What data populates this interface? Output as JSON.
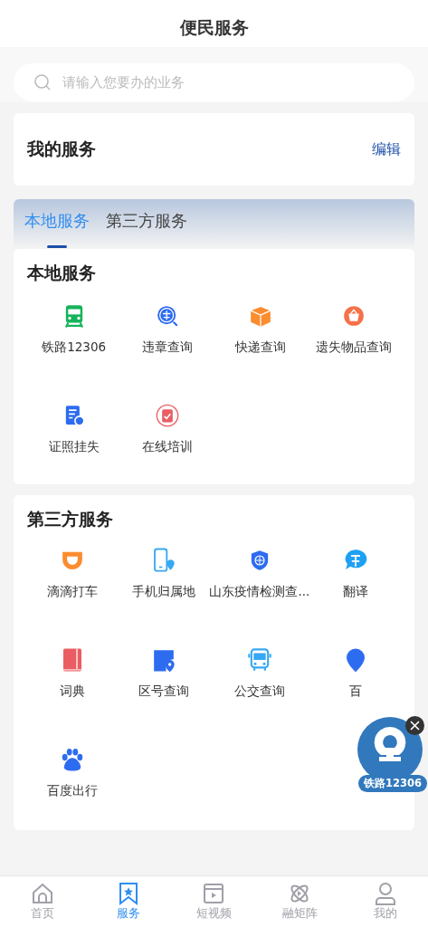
{
  "header": {
    "title": "便民服务"
  },
  "search": {
    "placeholder": "请输入您要办的业务"
  },
  "my_services": {
    "title": "我的服务",
    "action": "编辑"
  },
  "tabs": [
    {
      "label": "本地服务",
      "selected": true
    },
    {
      "label": "第三方服务",
      "selected": false
    }
  ],
  "sections": [
    {
      "title": "本地服务",
      "items": [
        {
          "label": "铁路12306"
        },
        {
          "label": "违章查询"
        },
        {
          "label": "快递查询"
        },
        {
          "label": "遗失物品查询"
        },
        {
          "label": "证照挂失"
        },
        {
          "label": "在线培训"
        }
      ]
    },
    {
      "title": "第三方服务",
      "items": [
        {
          "label": "滴滴打车"
        },
        {
          "label": "手机归属地"
        },
        {
          "label": "山东疫情检测查..."
        },
        {
          "label": "翻译"
        },
        {
          "label": "词典"
        },
        {
          "label": "区号查询"
        },
        {
          "label": "公交查询"
        },
        {
          "label": "百"
        },
        {
          "label": "百度出行"
        }
      ]
    }
  ],
  "floating_badge": {
    "label": "铁路12306"
  },
  "bottom_nav": [
    {
      "label": "首页",
      "selected": false
    },
    {
      "label": "服务",
      "selected": true
    },
    {
      "label": "短视频",
      "selected": false
    },
    {
      "label": "融矩阵",
      "selected": false
    },
    {
      "label": "我的",
      "selected": false
    }
  ]
}
